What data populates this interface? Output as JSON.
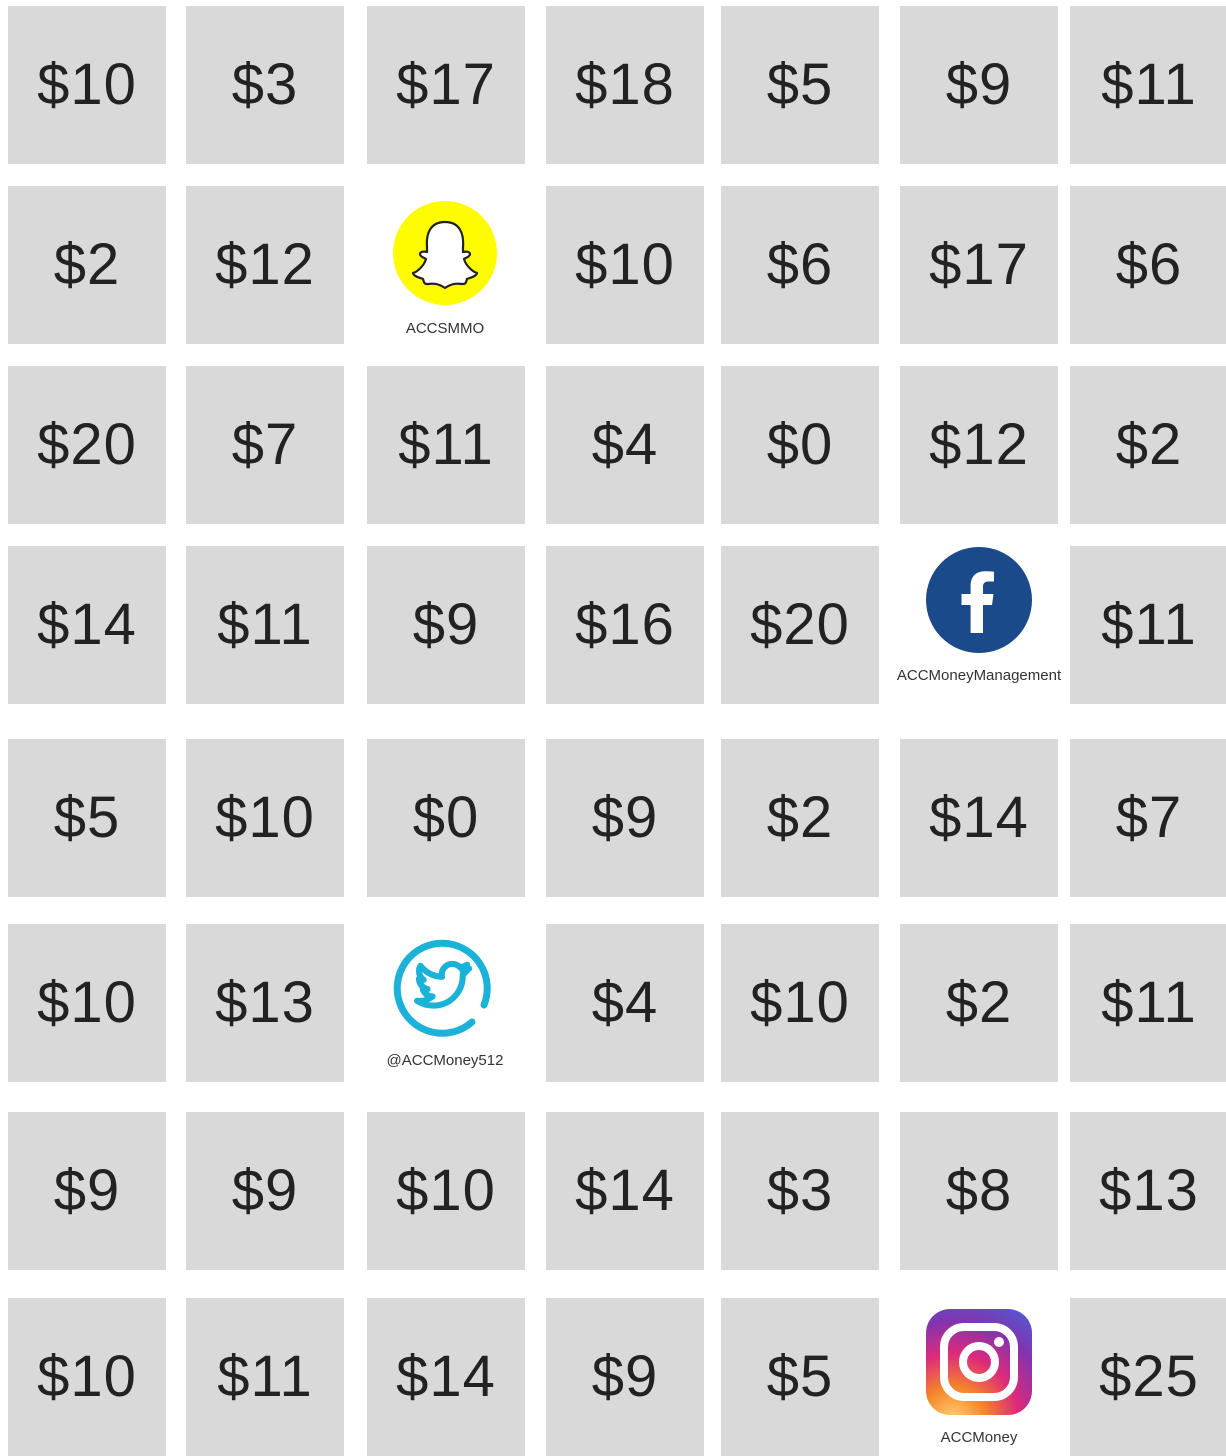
{
  "board": {
    "rows": [
      [
        "$10",
        "$3",
        "$17",
        "$18",
        "$5",
        "$9",
        "$11"
      ],
      [
        "$2",
        "$12",
        null,
        "$10",
        "$6",
        "$17",
        "$6"
      ],
      [
        "$20",
        "$7",
        "$11",
        "$4",
        "$0",
        "$12",
        "$2"
      ],
      [
        "$14",
        "$11",
        "$9",
        "$16",
        "$20",
        null,
        "$11"
      ],
      [
        "$5",
        "$10",
        "$0",
        "$9",
        "$2",
        "$14",
        "$7"
      ],
      [
        "$10",
        "$13",
        null,
        "$4",
        "$10",
        "$2",
        "$11"
      ],
      [
        "$9",
        "$9",
        "$10",
        "$14",
        "$3",
        "$8",
        "$13"
      ],
      [
        "$10",
        "$11",
        "$14",
        "$9",
        "$5",
        null,
        "$25"
      ]
    ]
  },
  "socials": {
    "snapchat": {
      "icon": "snapchat-icon",
      "handle": "ACCSMMO",
      "color": "#FFFC00"
    },
    "facebook": {
      "icon": "facebook-icon",
      "handle": "ACCMoneyManagement",
      "color": "#1B4A8A"
    },
    "twitter": {
      "icon": "twitter-icon",
      "handle": "@ACCMoney512",
      "color": "#1BB1D8"
    },
    "instagram": {
      "icon": "instagram-icon",
      "handle": "ACCMoney"
    }
  },
  "colors": {
    "tile": "#D9D9D9",
    "text": "#222222",
    "background": "#FFFFFF"
  }
}
